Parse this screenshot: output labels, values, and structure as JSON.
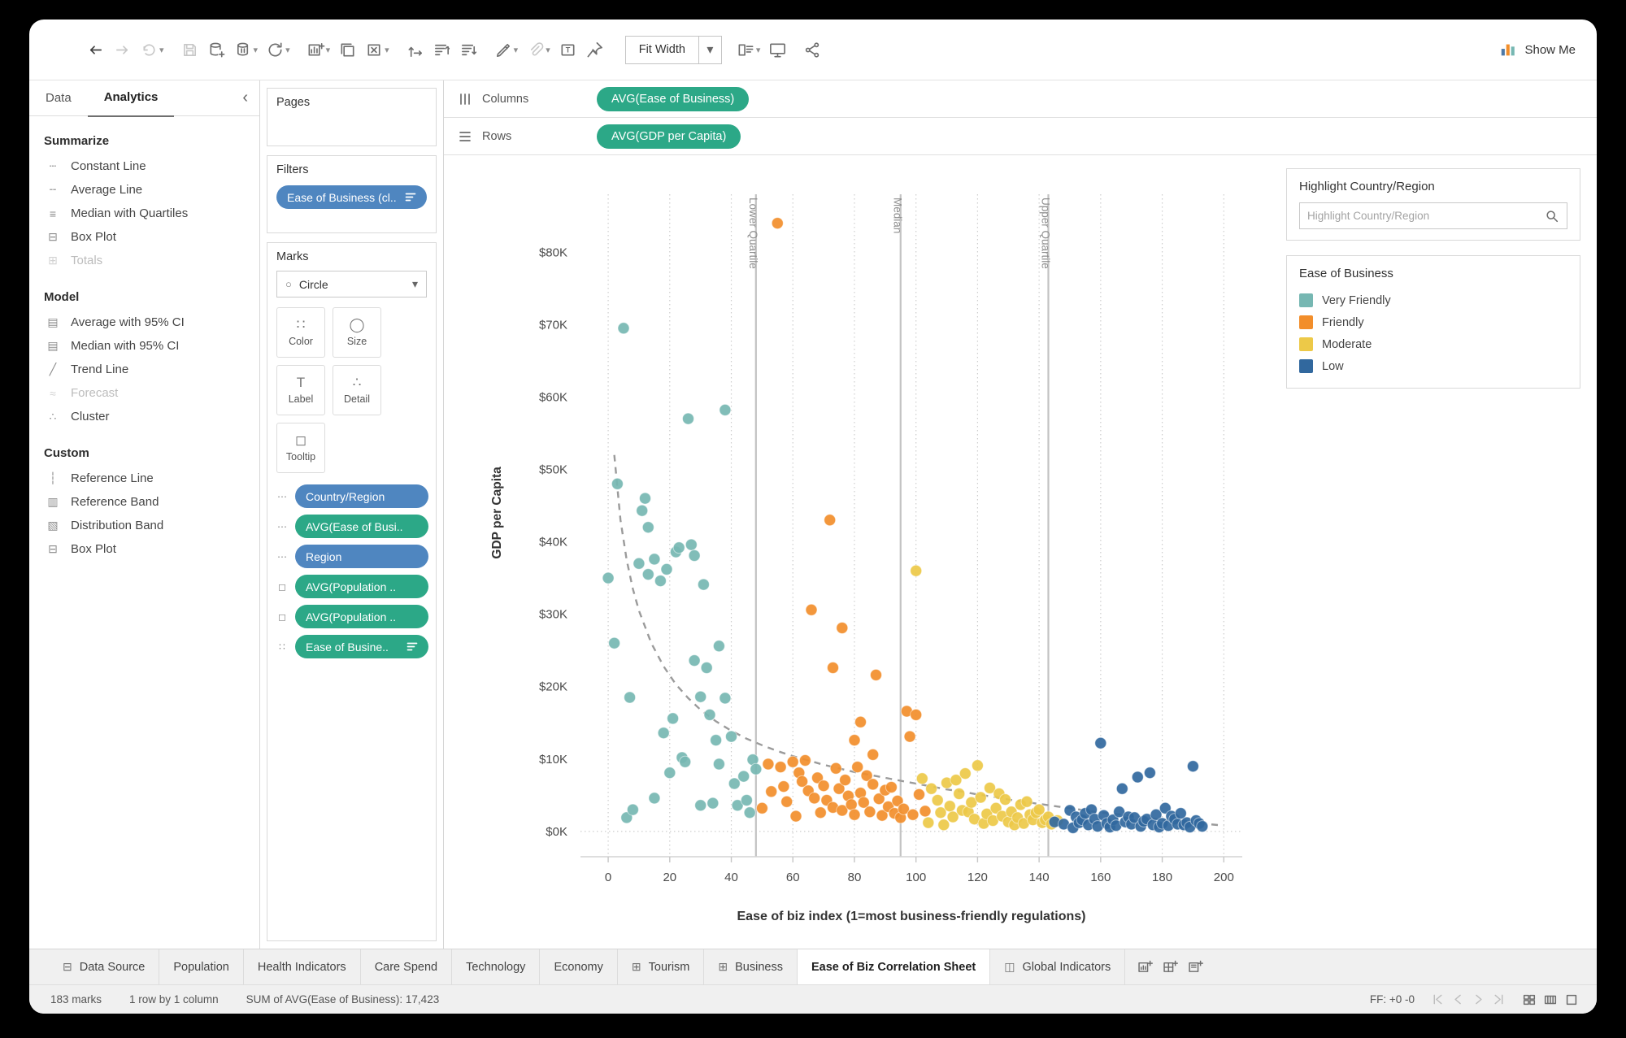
{
  "ui": {
    "caret": "▾",
    "chevron_left": "‹"
  },
  "toolbar": {
    "fit_label": "Fit Width",
    "show_me_label": "Show Me",
    "label_icon_glyph": "T"
  },
  "colors": {
    "pill_green": "#2CA887",
    "pill_blue": "#4F86C0"
  },
  "sidebar": {
    "tabs": [
      {
        "label": "Data"
      },
      {
        "label": "Analytics",
        "active": true
      }
    ],
    "sections": [
      {
        "title": "Summarize",
        "items": [
          {
            "label": "Constant Line",
            "glyph": "┄",
            "icon": "constant-line-icon"
          },
          {
            "label": "Average Line",
            "glyph": "╌",
            "icon": "average-line-icon"
          },
          {
            "label": "Median with Quartiles",
            "glyph": "≡",
            "icon": "median-quartiles-icon"
          },
          {
            "label": "Box Plot",
            "glyph": "⊟",
            "icon": "box-plot-icon"
          },
          {
            "label": "Totals",
            "glyph": "⊞",
            "icon": "totals-icon",
            "disabled": true
          }
        ]
      },
      {
        "title": "Model",
        "items": [
          {
            "label": "Average with 95% CI",
            "glyph": "▤",
            "icon": "average-ci-icon"
          },
          {
            "label": "Median with 95% CI",
            "glyph": "▤",
            "icon": "median-ci-icon"
          },
          {
            "label": "Trend Line",
            "glyph": "╱",
            "icon": "trend-line-icon"
          },
          {
            "label": "Forecast",
            "glyph": "≈",
            "icon": "forecast-icon",
            "disabled": true
          },
          {
            "label": "Cluster",
            "glyph": "∴",
            "icon": "cluster-icon"
          }
        ]
      },
      {
        "title": "Custom",
        "items": [
          {
            "label": "Reference Line",
            "glyph": "┆",
            "icon": "reference-line-icon"
          },
          {
            "label": "Reference Band",
            "glyph": "▥",
            "icon": "reference-band-icon"
          },
          {
            "label": "Distribution Band",
            "glyph": "▧",
            "icon": "distribution-band-icon"
          },
          {
            "label": "Box Plot",
            "glyph": "⊟",
            "icon": "box-plot-icon"
          }
        ]
      }
    ]
  },
  "cards": {
    "pages_title": "Pages",
    "filters_title": "Filters",
    "marks_title": "Marks"
  },
  "filters": {
    "pills": [
      {
        "label": "Ease of Business (cl..",
        "blue": true,
        "sorted": true,
        "glyph": "",
        "icon": "filter-icon"
      }
    ]
  },
  "marks": {
    "type_glyph": "○",
    "type_label": "Circle",
    "buttons": [
      {
        "label": "Color",
        "glyph": "∷",
        "icon": "color-icon"
      },
      {
        "label": "Size",
        "glyph": "◯",
        "icon": "size-icon"
      },
      {
        "label": "Label",
        "glyph": "T",
        "icon": "label-icon"
      },
      {
        "label": "Detail",
        "glyph": "∴",
        "icon": "detail-icon"
      },
      {
        "label": "Tooltip",
        "glyph": "◻",
        "icon": "tooltip-icon"
      }
    ],
    "pills": [
      {
        "label": "Country/Region",
        "blue": true,
        "glyph": "⋯",
        "icon": "detail-icon"
      },
      {
        "label": "AVG(Ease of Busi..",
        "glyph": "⋯",
        "icon": "detail-icon"
      },
      {
        "label": "Region",
        "blue": true,
        "glyph": "⋯",
        "icon": "detail-icon"
      },
      {
        "label": "AVG(Population ..",
        "glyph": "◻",
        "icon": "tooltip-icon"
      },
      {
        "label": "AVG(Population ..",
        "glyph": "◻",
        "icon": "tooltip-icon"
      },
      {
        "label": "Ease of Busine..",
        "glyph": "∷",
        "icon": "color-icon",
        "sorted": true
      }
    ]
  },
  "shelves": {
    "columns_label": "Columns",
    "rows_label": "Rows",
    "columns_pills": [
      {
        "label": "AVG(Ease of Business)"
      }
    ],
    "rows_pills": [
      {
        "label": "AVG(GDP per Capita)"
      }
    ]
  },
  "right_panel": {
    "highlight_card_title": "Highlight Country/Region",
    "search_placeholder": "Highlight Country/Region",
    "legend_title": "Ease of Business",
    "legend_items": [
      {
        "label": "Very Friendly",
        "color": "#76B7B2"
      },
      {
        "label": "Friendly",
        "color": "#F28E2B"
      },
      {
        "label": "Moderate",
        "color": "#EDC948"
      },
      {
        "label": "Low",
        "color": "#31689E"
      }
    ]
  },
  "chart_data": {
    "type": "scatter",
    "xlabel": "Ease of biz index (1=most business-friendly regulations)",
    "ylabel": "GDP per Capita",
    "x_view": [
      -9,
      206
    ],
    "y_view_thousands": [
      -3.5,
      88
    ],
    "x_ticks": [
      0,
      20,
      40,
      60,
      80,
      100,
      120,
      140,
      160,
      180,
      200
    ],
    "y_ticks_thousands": [
      0,
      10,
      20,
      30,
      40,
      50,
      60,
      70,
      80
    ],
    "y_tick_prefix": "$",
    "y_tick_suffix": "K",
    "grid": "x-dotted-vertical, dotted zero line",
    "legend_position": "right",
    "reference_lines": [
      {
        "value": 48,
        "label": "Lower Quartile"
      },
      {
        "value": 95,
        "label": "Median"
      },
      {
        "value": 143,
        "label": "Upper Quartile"
      }
    ],
    "trend_dashed": [
      [
        2,
        52
      ],
      [
        4,
        43
      ],
      [
        6,
        37.5
      ],
      [
        8,
        33.5
      ],
      [
        10,
        30.5
      ],
      [
        14,
        26
      ],
      [
        18,
        22.8
      ],
      [
        22,
        20.3
      ],
      [
        26,
        18.4
      ],
      [
        30,
        16.8
      ],
      [
        35,
        15.2
      ],
      [
        40,
        13.9
      ],
      [
        45,
        12.8
      ],
      [
        50,
        11.9
      ],
      [
        55,
        11.1
      ],
      [
        60,
        10.4
      ],
      [
        65,
        9.8
      ],
      [
        70,
        9.2
      ],
      [
        75,
        8.7
      ],
      [
        80,
        8.2
      ],
      [
        85,
        7.8
      ],
      [
        90,
        7.4
      ],
      [
        95,
        7
      ],
      [
        100,
        6.6
      ],
      [
        105,
        6.2
      ],
      [
        110,
        5.8
      ],
      [
        115,
        5.5
      ],
      [
        120,
        5.1
      ],
      [
        125,
        4.8
      ],
      [
        130,
        4.4
      ],
      [
        135,
        4.1
      ],
      [
        140,
        3.8
      ],
      [
        145,
        3.5
      ],
      [
        150,
        3.2
      ],
      [
        155,
        2.9
      ],
      [
        160,
        2.6
      ],
      [
        165,
        2.4
      ],
      [
        170,
        2.1
      ],
      [
        175,
        1.9
      ],
      [
        180,
        1.6
      ],
      [
        185,
        1.4
      ],
      [
        190,
        1.2
      ],
      [
        195,
        1
      ],
      [
        200,
        0.8
      ]
    ],
    "series": [
      {
        "name": "Very Friendly",
        "color": "#76B7B2",
        "points": [
          [
            0,
            35
          ],
          [
            2,
            26
          ],
          [
            3,
            48
          ],
          [
            5,
            69.5
          ],
          [
            6,
            1.9
          ],
          [
            7,
            18.5
          ],
          [
            8,
            3
          ],
          [
            10,
            37
          ],
          [
            11,
            44.3
          ],
          [
            12,
            46
          ],
          [
            13,
            42
          ],
          [
            13,
            35.5
          ],
          [
            15,
            37.6
          ],
          [
            15,
            4.6
          ],
          [
            17,
            34.6
          ],
          [
            18,
            13.6
          ],
          [
            19,
            36.2
          ],
          [
            20,
            8.1
          ],
          [
            21,
            15.6
          ],
          [
            22,
            38.6
          ],
          [
            23,
            39.2
          ],
          [
            24,
            10.2
          ],
          [
            25,
            9.6
          ],
          [
            26,
            57
          ],
          [
            27,
            39.6
          ],
          [
            28,
            38.1
          ],
          [
            28,
            23.6
          ],
          [
            30,
            18.6
          ],
          [
            30,
            3.6
          ],
          [
            31,
            34.1
          ],
          [
            32,
            22.6
          ],
          [
            33,
            16.1
          ],
          [
            34,
            3.9
          ],
          [
            35,
            12.6
          ],
          [
            36,
            25.6
          ],
          [
            36,
            9.3
          ],
          [
            38,
            58.2
          ],
          [
            38,
            18.4
          ],
          [
            40,
            13.1
          ],
          [
            41,
            6.6
          ],
          [
            42,
            3.6
          ],
          [
            44,
            7.6
          ],
          [
            45,
            4.3
          ],
          [
            46,
            2.6
          ],
          [
            47,
            9.9
          ],
          [
            48,
            8.6
          ]
        ]
      },
      {
        "name": "Friendly",
        "color": "#F28E2B",
        "points": [
          [
            55,
            84
          ],
          [
            72,
            43
          ],
          [
            66,
            30.6
          ],
          [
            76,
            28.1
          ],
          [
            73,
            22.6
          ],
          [
            87,
            21.6
          ],
          [
            80,
            12.6
          ],
          [
            82,
            15.1
          ],
          [
            86,
            10.6
          ],
          [
            97,
            16.6
          ],
          [
            98,
            13.1
          ],
          [
            52,
            9.3
          ],
          [
            53,
            5.5
          ],
          [
            50,
            3.2
          ],
          [
            56,
            8.9
          ],
          [
            57,
            6.2
          ],
          [
            58,
            4.1
          ],
          [
            60,
            9.6
          ],
          [
            61,
            2.1
          ],
          [
            62,
            8.1
          ],
          [
            63,
            6.9
          ],
          [
            64,
            9.8
          ],
          [
            65,
            5.6
          ],
          [
            67,
            4.6
          ],
          [
            68,
            7.4
          ],
          [
            69,
            2.6
          ],
          [
            70,
            6.3
          ],
          [
            71,
            4.3
          ],
          [
            73,
            3.3
          ],
          [
            74,
            8.7
          ],
          [
            75,
            5.9
          ],
          [
            76,
            2.9
          ],
          [
            77,
            7.1
          ],
          [
            78,
            4.9
          ],
          [
            79,
            3.7
          ],
          [
            80,
            2.3
          ],
          [
            81,
            8.9
          ],
          [
            82,
            5.3
          ],
          [
            83,
            4
          ],
          [
            84,
            7.7
          ],
          [
            85,
            2.7
          ],
          [
            86,
            6.5
          ],
          [
            88,
            4.5
          ],
          [
            89,
            2.2
          ],
          [
            90,
            5.7
          ],
          [
            91,
            3.4
          ],
          [
            92,
            6.1
          ],
          [
            93,
            2.5
          ],
          [
            94,
            4.2
          ],
          [
            95,
            1.9
          ],
          [
            96,
            3.1
          ],
          [
            99,
            2.3
          ],
          [
            100,
            16.1
          ],
          [
            101,
            5.1
          ],
          [
            103,
            2.8
          ]
        ]
      },
      {
        "name": "Moderate",
        "color": "#EDC948",
        "points": [
          [
            100,
            36
          ],
          [
            102,
            7.3
          ],
          [
            104,
            1.2
          ],
          [
            105,
            5.9
          ],
          [
            107,
            4.3
          ],
          [
            108,
            2.6
          ],
          [
            109,
            0.9
          ],
          [
            110,
            6.7
          ],
          [
            111,
            3.5
          ],
          [
            112,
            2
          ],
          [
            113,
            7.1
          ],
          [
            114,
            5.2
          ],
          [
            115,
            2.9
          ],
          [
            116,
            8
          ],
          [
            117,
            2.7
          ],
          [
            118,
            4
          ],
          [
            119,
            1.7
          ],
          [
            120,
            9.1
          ],
          [
            121,
            4.7
          ],
          [
            122,
            1.1
          ],
          [
            123,
            2.4
          ],
          [
            124,
            6
          ],
          [
            125,
            1.5
          ],
          [
            126,
            3.2
          ],
          [
            127,
            5.2
          ],
          [
            128,
            2.1
          ],
          [
            129,
            4.4
          ],
          [
            130,
            1.3
          ],
          [
            131,
            2.7
          ],
          [
            132,
            0.9
          ],
          [
            133,
            1.9
          ],
          [
            134,
            3.7
          ],
          [
            135,
            1.1
          ],
          [
            136,
            4.1
          ],
          [
            137,
            2.3
          ],
          [
            138,
            1.6
          ],
          [
            139,
            2.6
          ],
          [
            140,
            3
          ],
          [
            141,
            1.2
          ],
          [
            142,
            1.6
          ],
          [
            143,
            2
          ],
          [
            144,
            1
          ],
          [
            146,
            1.5
          ]
        ]
      },
      {
        "name": "Low",
        "color": "#31689E",
        "points": [
          [
            160,
            12.2
          ],
          [
            172,
            7.5
          ],
          [
            176,
            8.1
          ],
          [
            190,
            9
          ],
          [
            167,
            5.9
          ],
          [
            145,
            1.3
          ],
          [
            148,
            1
          ],
          [
            150,
            2.9
          ],
          [
            151,
            0.5
          ],
          [
            152,
            2
          ],
          [
            153,
            1.2
          ],
          [
            154,
            1.6
          ],
          [
            155,
            2.5
          ],
          [
            156,
            0.9
          ],
          [
            157,
            3
          ],
          [
            158,
            1.7
          ],
          [
            159,
            0.7
          ],
          [
            161,
            2.2
          ],
          [
            162,
            1.1
          ],
          [
            163,
            0.6
          ],
          [
            164,
            1.6
          ],
          [
            165,
            0.8
          ],
          [
            166,
            2.7
          ],
          [
            168,
            1.3
          ],
          [
            169,
            2
          ],
          [
            170,
            1
          ],
          [
            171,
            1.9
          ],
          [
            173,
            0.7
          ],
          [
            174,
            1.4
          ],
          [
            175,
            1.7
          ],
          [
            177,
            0.9
          ],
          [
            178,
            2.3
          ],
          [
            179,
            0.6
          ],
          [
            180,
            1.1
          ],
          [
            181,
            3.2
          ],
          [
            182,
            0.8
          ],
          [
            183,
            2.1
          ],
          [
            184,
            1.7
          ],
          [
            185,
            1
          ],
          [
            186,
            2.5
          ],
          [
            187,
            0.9
          ],
          [
            188,
            1.2
          ],
          [
            189,
            0.6
          ],
          [
            191,
            1.5
          ],
          [
            192,
            1.1
          ],
          [
            193,
            0.7
          ]
        ]
      }
    ]
  },
  "sheet_tabs": {
    "tabs": [
      {
        "label": "Data Source",
        "glyph": "⊟",
        "icon": "data-source-icon"
      },
      {
        "label": "Population"
      },
      {
        "label": "Health Indicators"
      },
      {
        "label": "Care Spend"
      },
      {
        "label": "Technology"
      },
      {
        "label": "Economy"
      },
      {
        "label": "Tourism",
        "glyph": "⊞",
        "icon": "worksheet-icon"
      },
      {
        "label": "Business",
        "glyph": "⊞",
        "icon": "worksheet-icon"
      },
      {
        "label": "Ease of Biz Correlation Sheet",
        "active": true
      },
      {
        "label": "Global Indicators",
        "glyph": "◫",
        "icon": "dashboard-icon"
      }
    ]
  },
  "status_bar": {
    "marks_count": "183 marks",
    "grid_info": "1 row by 1 column",
    "aggregate_info": "SUM of AVG(Ease of Business): 17,423",
    "ff_info": "FF: +0 -0"
  }
}
